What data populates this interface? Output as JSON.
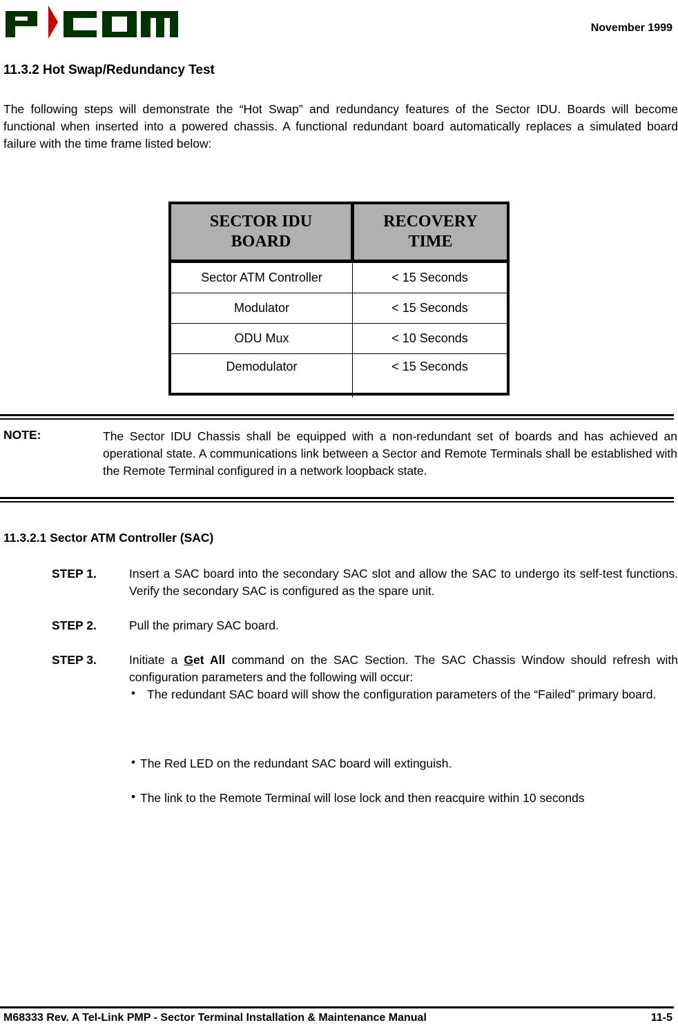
{
  "header": {
    "logo_text": "P-COM",
    "logo_colors": {
      "letters": "#003300",
      "arrow": "#cc0000"
    },
    "date": "November 1999"
  },
  "section": {
    "title": "11.3.2  Hot Swap/Redundancy Test",
    "intro": "The following steps will demonstrate the “Hot Swap” and redundancy features of the Sector IDU. Boards will become functional when inserted into a powered chassis. A functional redundant board automatically replaces a simulated board failure with the time frame listed below:"
  },
  "table": {
    "headers": [
      "SECTOR IDU BOARD",
      "RECOVERY TIME"
    ],
    "header_lines": [
      [
        "SECTOR IDU",
        "BOARD"
      ],
      [
        "RECOVERY",
        "TIME"
      ]
    ],
    "rows": [
      [
        "Sector ATM Controller",
        "< 15 Seconds"
      ],
      [
        "Modulator",
        "< 15 Seconds"
      ],
      [
        "ODU Mux",
        "< 10 Seconds"
      ],
      [
        "Demodulator",
        "< 15 Seconds"
      ]
    ]
  },
  "note": {
    "label": "NOTE:",
    "text": "The Sector IDU Chassis shall be equipped with a non-redundant set of boards and has achieved an operational state. A communications link between a Sector and Remote Terminals shall be established with the Remote Terminal configured in a network loopback state."
  },
  "subsection": {
    "title": "11.3.2.1 Sector ATM Controller (SAC)",
    "steps": [
      {
        "label": "STEP 1.",
        "text": "Insert a SAC board into the secondary SAC slot and allow the SAC to undergo its self-test functions. Verify the secondary SAC is configured as the spare unit."
      },
      {
        "label": "STEP 2.",
        "text": "Pull the primary SAC board."
      },
      {
        "label": "STEP 3.",
        "text_before": "Initiate a ",
        "command_underlined": "G",
        "command_rest": "et All",
        "text_after": " command on the SAC Section. The SAC Chassis Window should refresh with configuration parameters and the following will occur:"
      }
    ],
    "bullets": [
      "The redundant SAC board will show the configuration parameters of the “Failed” primary board.",
      "The Red LED on the redundant SAC board will extinguish.",
      "The link to the Remote Terminal will lose lock and then reacquire within 10 seconds"
    ]
  },
  "footer": {
    "manual": "M68333 Rev. A Tel-Link PMP - Sector Terminal Installation & Maintenance Manual",
    "page": "11-5"
  }
}
